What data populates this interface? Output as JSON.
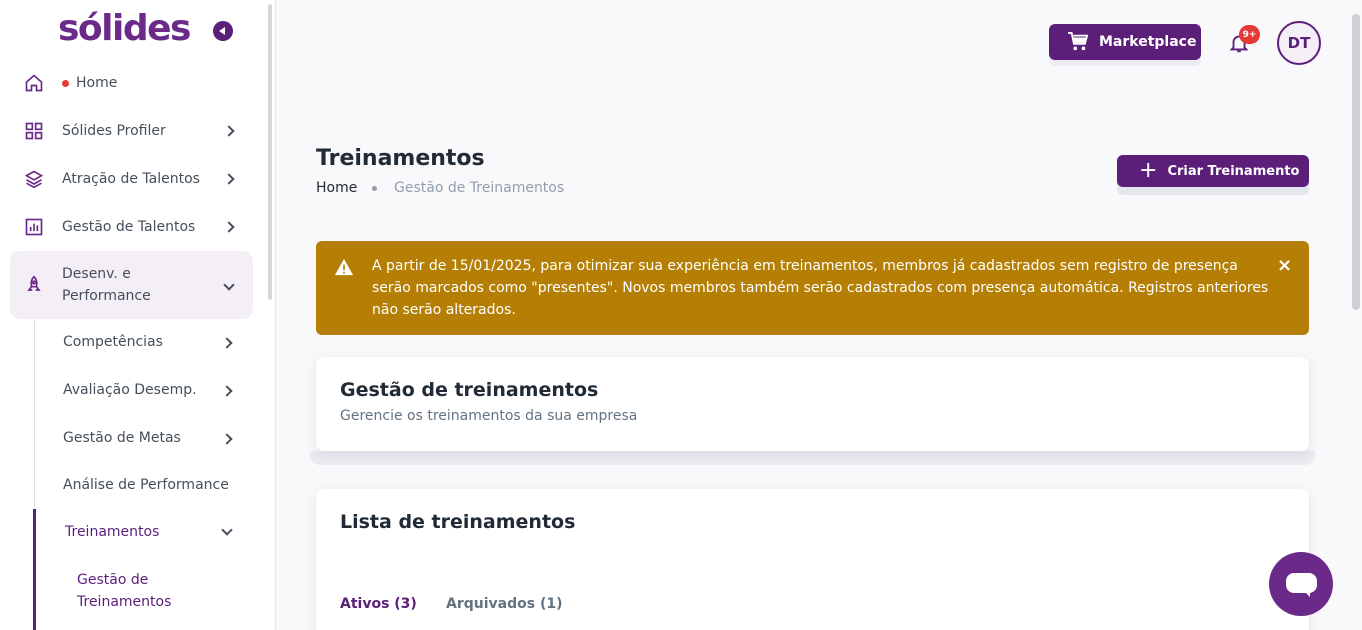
{
  "brand": {
    "logo_text": "sólides",
    "accent_color": "#5b1f7a"
  },
  "sidebar": {
    "home": {
      "label": "Home"
    },
    "items": [
      {
        "label": "Sólides Profiler",
        "icon": "grid-icon"
      },
      {
        "label": "Atração de Talentos",
        "icon": "layers-icon"
      },
      {
        "label": "Gestão de Talentos",
        "icon": "bar-chart-icon"
      }
    ],
    "active": {
      "label_line1": "Desenv. e",
      "label_line2": "Performance",
      "icon": "rocket-icon"
    },
    "subitems": [
      {
        "label": "Competências"
      },
      {
        "label": "Avaliação Desemp."
      },
      {
        "label": "Gestão de Metas"
      },
      {
        "label": "Análise de Performance"
      },
      {
        "label": "Treinamentos"
      }
    ],
    "subsub": {
      "line1": "Gestão de",
      "line2": "Treinamentos"
    }
  },
  "header": {
    "marketplace_label": "Marketplace",
    "notifications_badge": "9+",
    "avatar_initials": "DT"
  },
  "page": {
    "title": "Treinamentos",
    "breadcrumb": {
      "home": "Home",
      "current": "Gestão de Treinamentos"
    },
    "create_button": "Criar Treinamento",
    "alert_text": "A partir de 15/01/2025, para otimizar sua experiência em treinamentos, membros já cadastrados sem registro de presença serão marcados como \"presentes\". Novos membros também serão cadastrados com presença automática. Registros anteriores não serão alterados.",
    "alert_close": "×",
    "card1": {
      "title": "Gestão de treinamentos",
      "subtitle": "Gerencie os treinamentos da sua empresa"
    },
    "card2": {
      "title": "Lista de treinamentos"
    },
    "tabs": [
      {
        "label": "Ativos (3)"
      },
      {
        "label": "Arquivados (1)"
      }
    ]
  }
}
